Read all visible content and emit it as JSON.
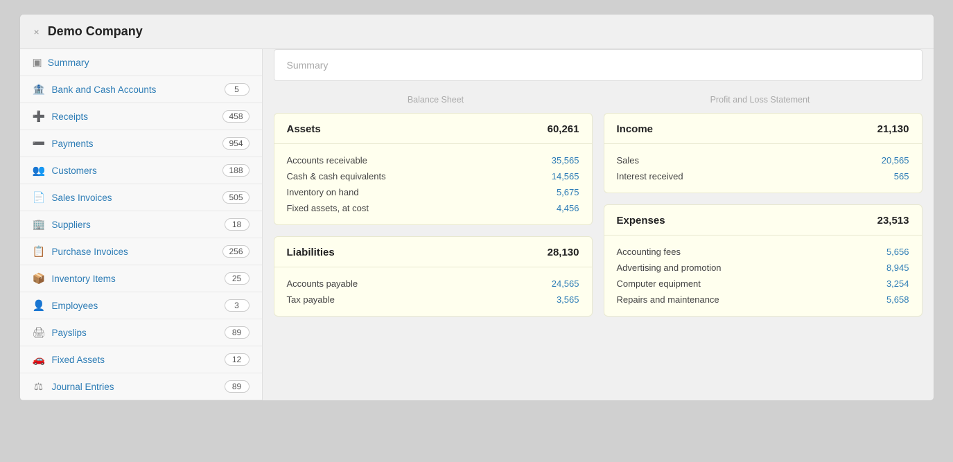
{
  "window": {
    "title": "Demo Company",
    "close_label": "×"
  },
  "sidebar": {
    "summary_label": "Summary",
    "items": [
      {
        "id": "bank-cash",
        "label": "Bank and Cash Accounts",
        "badge": "5",
        "icon": "🏦"
      },
      {
        "id": "receipts",
        "label": "Receipts",
        "badge": "458",
        "icon": "➕"
      },
      {
        "id": "payments",
        "label": "Payments",
        "badge": "954",
        "icon": "➖"
      },
      {
        "id": "customers",
        "label": "Customers",
        "badge": "188",
        "icon": "👥"
      },
      {
        "id": "sales-invoices",
        "label": "Sales Invoices",
        "badge": "505",
        "icon": "📄"
      },
      {
        "id": "suppliers",
        "label": "Suppliers",
        "badge": "18",
        "icon": "🏢"
      },
      {
        "id": "purchase-invoices",
        "label": "Purchase Invoices",
        "badge": "256",
        "icon": "📋"
      },
      {
        "id": "inventory-items",
        "label": "Inventory Items",
        "badge": "25",
        "icon": "📦"
      },
      {
        "id": "employees",
        "label": "Employees",
        "badge": "3",
        "icon": "👤"
      },
      {
        "id": "payslips",
        "label": "Payslips",
        "badge": "89",
        "icon": "🖨"
      },
      {
        "id": "fixed-assets",
        "label": "Fixed Assets",
        "badge": "12",
        "icon": "🚗"
      },
      {
        "id": "journal-entries",
        "label": "Journal Entries",
        "badge": "89",
        "icon": "⚖"
      }
    ]
  },
  "main": {
    "header_label": "Summary",
    "balance_sheet_label": "Balance Sheet",
    "profit_loss_label": "Profit and Loss Statement",
    "assets": {
      "title": "Assets",
      "total": "60,261",
      "rows": [
        {
          "label": "Accounts receivable",
          "value": "35,565"
        },
        {
          "label": "Cash & cash equivalents",
          "value": "14,565"
        },
        {
          "label": "Inventory on hand",
          "value": "5,675"
        },
        {
          "label": "Fixed assets, at cost",
          "value": "4,456"
        }
      ]
    },
    "liabilities": {
      "title": "Liabilities",
      "total": "28,130",
      "rows": [
        {
          "label": "Accounts payable",
          "value": "24,565"
        },
        {
          "label": "Tax payable",
          "value": "3,565"
        }
      ]
    },
    "income": {
      "title": "Income",
      "total": "21,130",
      "rows": [
        {
          "label": "Sales",
          "value": "20,565"
        },
        {
          "label": "Interest received",
          "value": "565"
        }
      ]
    },
    "expenses": {
      "title": "Expenses",
      "total": "23,513",
      "rows": [
        {
          "label": "Accounting fees",
          "value": "5,656"
        },
        {
          "label": "Advertising and promotion",
          "value": "8,945"
        },
        {
          "label": "Computer equipment",
          "value": "3,254"
        },
        {
          "label": "Repairs and maintenance",
          "value": "5,658"
        }
      ]
    }
  }
}
